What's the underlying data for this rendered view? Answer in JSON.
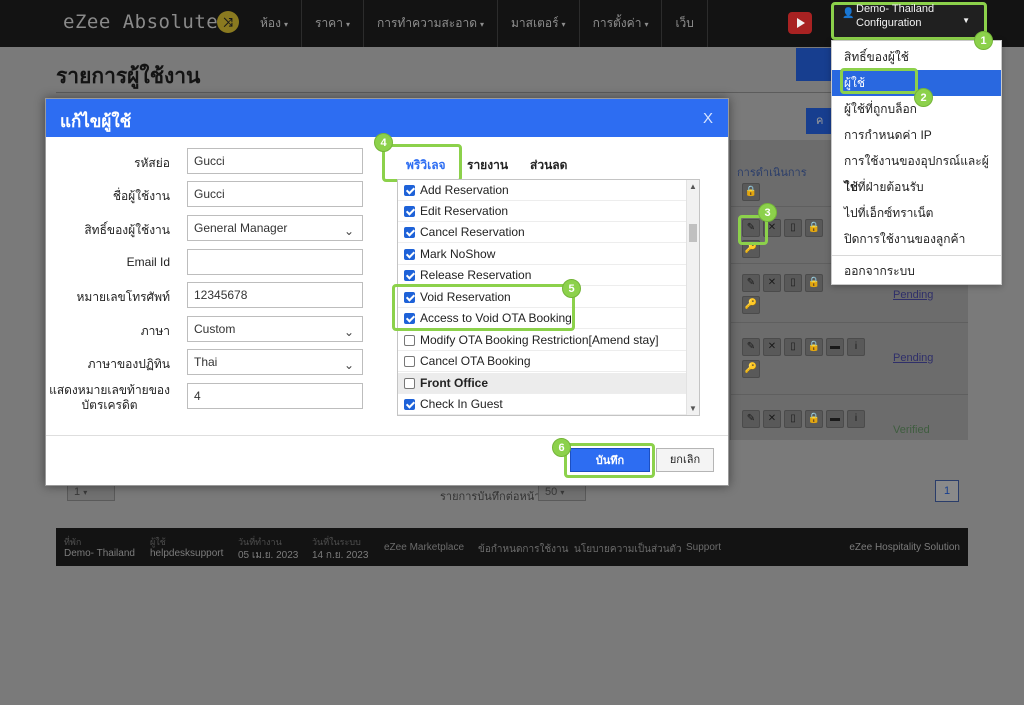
{
  "app": {
    "brand": "eZee Absolute",
    "nav": [
      {
        "label": "ห้อง"
      },
      {
        "label": "ราคา"
      },
      {
        "label": "การทำความสะอาด"
      },
      {
        "label": "มาสเตอร์"
      },
      {
        "label": "การตั้งค่า"
      },
      {
        "label": "เว็บ"
      }
    ],
    "user": {
      "line1": "Demo- Thailand",
      "line2": "Configuration"
    }
  },
  "page": {
    "title": "รายการผู้ใช้งาน",
    "action_col_header": "การดำเนินการ",
    "rows": [
      {
        "status": ""
      },
      {
        "status": "Pending"
      },
      {
        "status": "Pending"
      },
      {
        "status": "Verified"
      }
    ],
    "page_size": "1",
    "records_label": "รายการบันทึกต่อหน้า",
    "records_per_page": "50",
    "current_page": "1"
  },
  "dropdown": {
    "items": [
      {
        "label": "สิทธิ์ของผู้ใช้"
      },
      {
        "label": "ผู้ใช้"
      },
      {
        "label": "ผู้ใช้ที่ถูกบล็อก"
      },
      {
        "label": "การกำหนดค่า IP"
      },
      {
        "label": "การใช้งานของอุปกรณ์และผู้ใช้"
      },
      {
        "label": "ไปที่ฝ่ายต้อนรับ"
      },
      {
        "label": "ไปที่เอ็กซ์ทราเน็ต"
      },
      {
        "label": "ปิดการใช้งานของลูกค้า"
      }
    ],
    "logout": "ออกจากระบบ",
    "active_index": 1
  },
  "modal": {
    "title": "แก้ไขผู้ใช้",
    "close": "X",
    "fields": [
      {
        "label": "รหัสย่อ",
        "value": "Gucci",
        "type": "text"
      },
      {
        "label": "ชื่อผู้ใช้งาน",
        "value": "Gucci",
        "type": "text"
      },
      {
        "label": "สิทธิ์ของผู้ใช้งาน",
        "value": "General Manager",
        "type": "select"
      },
      {
        "label": "Email Id",
        "value": "",
        "type": "text"
      },
      {
        "label": "หมายเลขโทรศัพท์",
        "value": "12345678",
        "type": "text"
      },
      {
        "label": "ภาษา",
        "value": "Custom",
        "type": "select"
      },
      {
        "label": "ภาษาของปฏิทิน",
        "value": "Thai",
        "type": "select"
      },
      {
        "label_line1": "แสดงหมายเลขท้ายของ",
        "label_line2": "บัตรเครดิต",
        "value": "4",
        "type": "text"
      }
    ],
    "tabs": [
      {
        "label": "พริวิเลจ"
      },
      {
        "label": "รายงาน"
      },
      {
        "label": "ส่วนลด"
      }
    ],
    "permissions": [
      {
        "label": "Add Reservation",
        "checked": true
      },
      {
        "label": "Edit Reservation",
        "checked": true
      },
      {
        "label": "Cancel Reservation",
        "checked": true
      },
      {
        "label": "Mark NoShow",
        "checked": true
      },
      {
        "label": "Release Reservation",
        "checked": true
      },
      {
        "label": "Void Reservation",
        "checked": true
      },
      {
        "label": "Access to Void OTA Booking",
        "checked": true
      },
      {
        "label": "Modify OTA Booking Restriction[Amend stay]",
        "checked": false
      },
      {
        "label": "Cancel OTA Booking",
        "checked": false
      },
      {
        "label": "Front Office",
        "checked": false,
        "group": true
      },
      {
        "label": "Check In Guest",
        "checked": true
      }
    ],
    "save_label": "บันทึก",
    "cancel_label": "ยกเลิก"
  },
  "footer": {
    "cells": [
      {
        "key": "ที่พัก",
        "value": "Demo- Thailand"
      },
      {
        "key": "ผู้ใช้",
        "value": "helpdesksupport"
      },
      {
        "key": "วันที่ทำงาน",
        "value": "05 เม.ย. 2023"
      },
      {
        "key": "วันที่ในระบบ",
        "value": "14 ก.ย. 2023"
      }
    ],
    "links": [
      {
        "label": "eZee Marketplace"
      },
      {
        "label": "ข้อกำหนดการใช้งาน"
      },
      {
        "label": "นโยบายความเป็นส่วนตัว"
      },
      {
        "label": "Support"
      }
    ],
    "brand": "eZee Hospitality Solution"
  },
  "markers": [
    "1",
    "2",
    "3",
    "4",
    "5",
    "6"
  ],
  "colors": {
    "accent": "#2d6df2",
    "highlight": "#8cd14b",
    "menu_active": "#2968e0"
  }
}
